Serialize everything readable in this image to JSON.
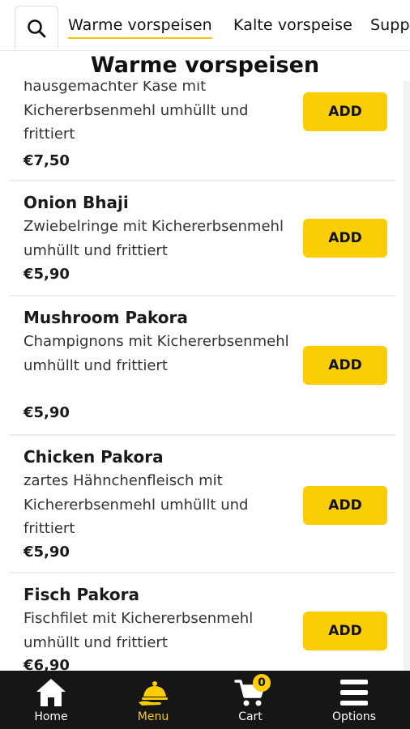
{
  "tabs": [
    "Warme vorspeisen",
    "Kalte vorspeise",
    "Supp"
  ],
  "section_title": "Warme vorspeisen",
  "items": [
    {
      "name": "",
      "desc": "hausgemachter Käse mit Kichererbsenmehl umhüllt und frittiert",
      "price": "€7,50",
      "add_label": "ADD"
    },
    {
      "name": "Onion Bhaji",
      "desc": "Zwiebelringe mit Kichererbsenmehl umhüllt und frittiert",
      "price": "€5,90",
      "add_label": "ADD"
    },
    {
      "name": "Mushroom Pakora",
      "desc": "Champignons mit Kichererbsenmehl umhüllt und frittiert",
      "price": "€5,90",
      "add_label": "ADD"
    },
    {
      "name": "Chicken Pakora",
      "desc": "zartes Hähnchenfleisch mit Kichererbsenmehl umhüllt und frittiert",
      "price": "€5,90",
      "add_label": "ADD"
    },
    {
      "name": "Fisch Pakora",
      "desc": "Fischfilet mit Kichererbsenmehl umhüllt und frittiert",
      "price": "€6,90",
      "add_label": "ADD"
    }
  ],
  "nav": {
    "home": "Home",
    "menu": "Menu",
    "cart": "Cart",
    "cart_count": "0",
    "options": "Options"
  },
  "colors": {
    "accent": "#fbcd05",
    "nav_bg": "#161616"
  }
}
